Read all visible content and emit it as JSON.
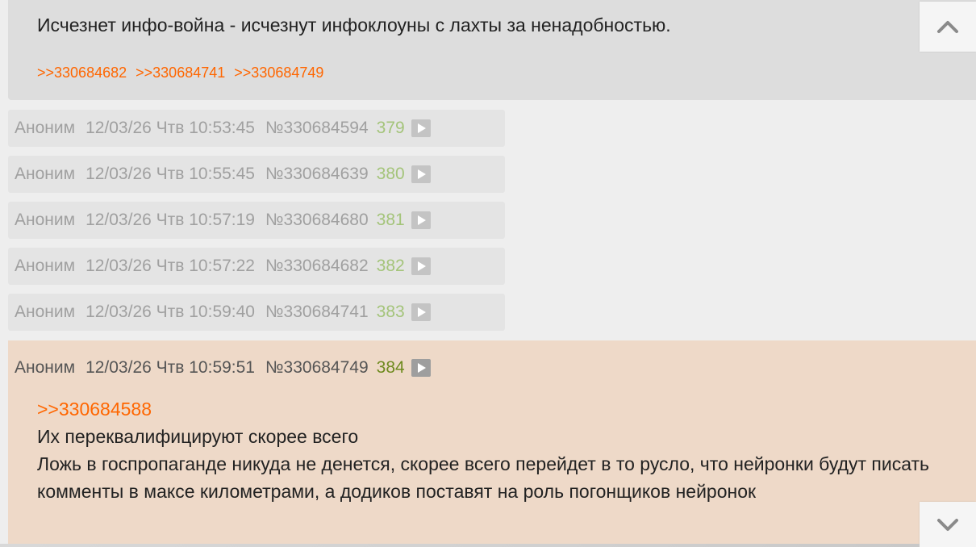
{
  "top_post": {
    "text": "Исчезнет инфо-война - исчезнут инфоклоуны с лахты за ненадобностью.",
    "replies": [
      ">>330684682",
      ">>330684741",
      ">>330684749"
    ]
  },
  "collapsed_posts": [
    {
      "name": "Аноним",
      "date": "12/03/26 Чтв 10:53:45",
      "number": "№330684594",
      "index": "379"
    },
    {
      "name": "Аноним",
      "date": "12/03/26 Чтв 10:55:45",
      "number": "№330684639",
      "index": "380"
    },
    {
      "name": "Аноним",
      "date": "12/03/26 Чтв 10:57:19",
      "number": "№330684680",
      "index": "381"
    },
    {
      "name": "Аноним",
      "date": "12/03/26 Чтв 10:57:22",
      "number": "№330684682",
      "index": "382"
    },
    {
      "name": "Аноним",
      "date": "12/03/26 Чтв 10:59:40",
      "number": "№330684741",
      "index": "383"
    }
  ],
  "main_post": {
    "name": "Аноним",
    "date": "12/03/26 Чтв 10:59:51",
    "number": "№330684749",
    "index": "384",
    "quote": ">>330684588",
    "lines": [
      "Их переквалифицируют скорее всего",
      "Ложь в госпропаганде никуда не денется, скорее всего перейдет в то русло, что нейронки будут писать комменты в максе километрами, а додиков поставят на роль погонщиков нейронок"
    ]
  },
  "icons": {
    "scroll_up": "chevron-up-icon",
    "scroll_down": "chevron-down-icon",
    "expand": "play-icon"
  },
  "colors": {
    "reply_link": "#ff6600",
    "highlight_bg": "#eed9c8",
    "post_index": "#a4c47a"
  }
}
